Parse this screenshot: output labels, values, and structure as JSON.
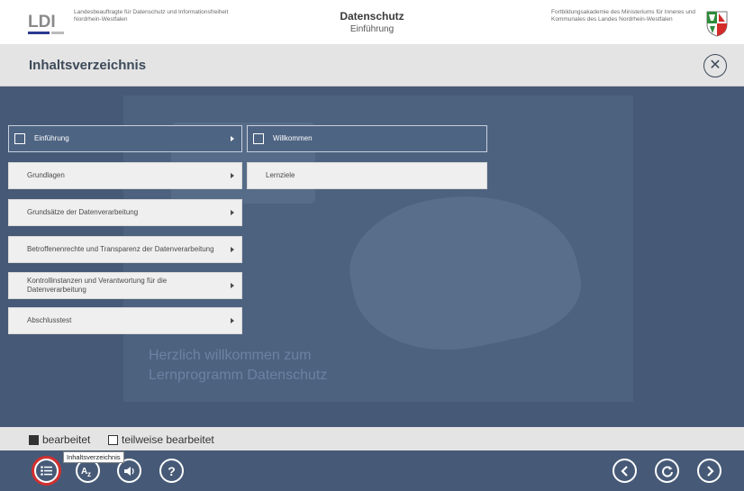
{
  "header": {
    "ldi_logo_text": "LDI",
    "ldi_text": "Landesbeauftragte für Datenschutz und Informationsfreiheit Nordrhein-Westfalen",
    "title": "Datenschutz",
    "subtitle": "Einführung",
    "fba_text": "Fortbildungsakademie des Ministeriums für Inneres und Kommunales des Landes Nordrhein-Westfalen"
  },
  "titlebar": {
    "title": "Inhaltsverzeichnis",
    "close_icon": "close-icon"
  },
  "background": {
    "tagline_line1": "Herzlich willkommen zum",
    "tagline_line2": "Lernprogramm Datenschutz"
  },
  "menu": {
    "chapters": [
      {
        "label": "Einführung",
        "active": true
      },
      {
        "label": "Grundlagen",
        "active": false
      },
      {
        "label": "Grundsätze der Datenverarbeitung",
        "active": false
      },
      {
        "label": "Betroffenenrechte und Transparenz der Datenverarbeitung",
        "active": false
      },
      {
        "label": "Kontrollinstanzen und Verantwortung für die Datenverarbeitung",
        "active": false
      },
      {
        "label": "Abschlusstest",
        "active": false
      }
    ],
    "pages": [
      {
        "label": "Willkommen",
        "active": true
      },
      {
        "label": "Lernziele",
        "active": false
      }
    ]
  },
  "legend": {
    "done": "bearbeitet",
    "partial": "teilweise bearbeitet"
  },
  "footer": {
    "tooltip": "Inhaltsverzeichnis",
    "buttons": {
      "toc": "list-icon",
      "glossary": "az-icon",
      "audio": "speaker-icon",
      "help": "?",
      "back": "chevron-left-icon",
      "reload": "reload-icon",
      "next": "chevron-right-icon"
    }
  },
  "colors": {
    "primary": "#465a77",
    "active_item": "#4e6483",
    "highlight": "#d32f2f",
    "logo_blue": "#2b3a8f"
  }
}
